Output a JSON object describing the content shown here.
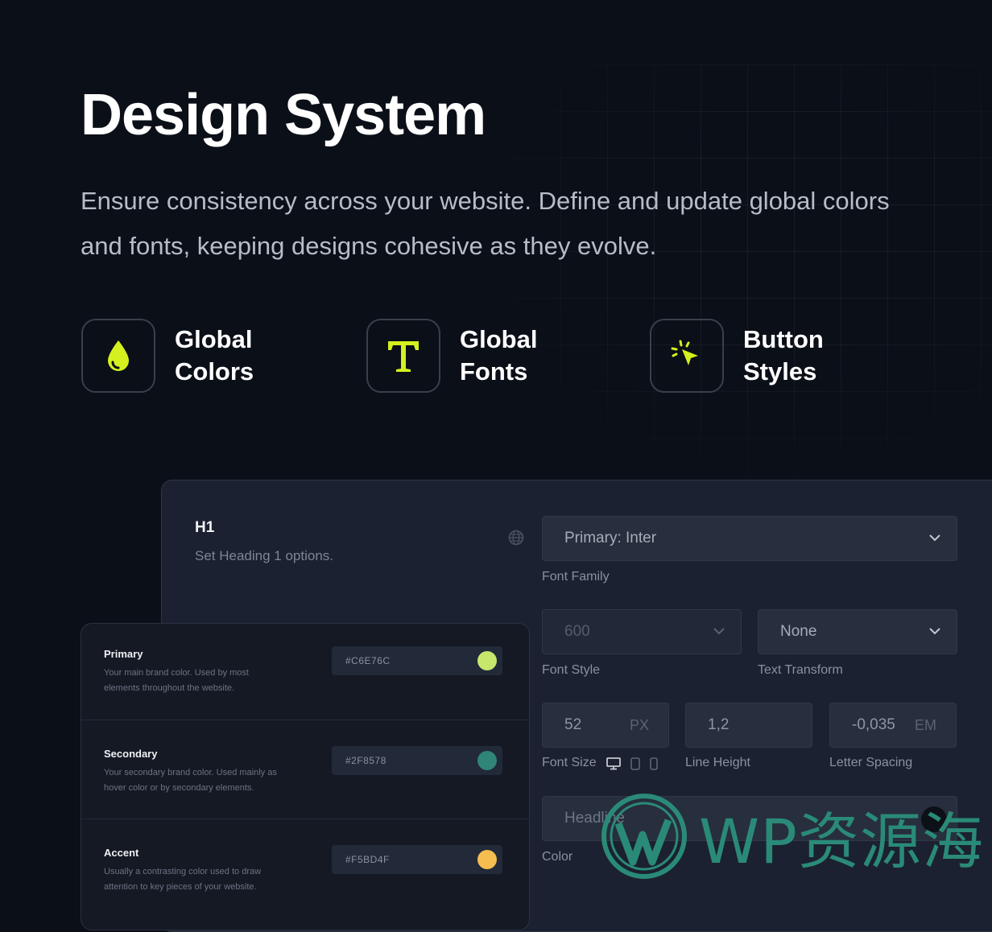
{
  "hero": {
    "title": "Design System",
    "subtitle": "Ensure consistency across your website. Define and update global colors and fonts, keeping designs cohesive as they evolve."
  },
  "features": [
    {
      "line1": "Global",
      "line2": "Colors",
      "icon": "drop-icon"
    },
    {
      "line1": "Global",
      "line2": "Fonts",
      "icon": "typography-t-icon"
    },
    {
      "line1": "Button",
      "line2": "Styles",
      "icon": "cursor-click-icon"
    }
  ],
  "accent_color": "#d4f01e",
  "typography_panel": {
    "heading": "H1",
    "description": "Set Heading 1 options.",
    "font_family": {
      "value": "Primary: Inter",
      "label": "Font Family"
    },
    "font_style": {
      "value": "600",
      "label": "Font Style"
    },
    "text_transform": {
      "value": "None",
      "label": "Text Transform"
    },
    "font_size": {
      "value": "52",
      "unit": "PX",
      "label": "Font Size"
    },
    "line_height": {
      "value": "1,2",
      "label": "Line Height"
    },
    "letter_spacing": {
      "value": "-0,035",
      "unit": "EM",
      "label": "Letter Spacing"
    },
    "color": {
      "value": "Headline",
      "label": "Color"
    }
  },
  "colors_panel": {
    "items": [
      {
        "name": "Primary",
        "description": "Your main brand color. Used by most elements throughout the website.",
        "hex": "#C6E76C",
        "swatch": "#c6e76c"
      },
      {
        "name": "Secondary",
        "description": "Your secondary brand color. Used mainly as hover color or by secondary elements.",
        "hex": "#2F8578",
        "swatch": "#2f8578"
      },
      {
        "name": "Accent",
        "description": "Usually a contrasting color used to draw attention to key pieces of your website.",
        "hex": "#F5BD4F",
        "swatch": "#f5bd4f"
      }
    ]
  },
  "watermark": {
    "text": "WP资源海"
  }
}
